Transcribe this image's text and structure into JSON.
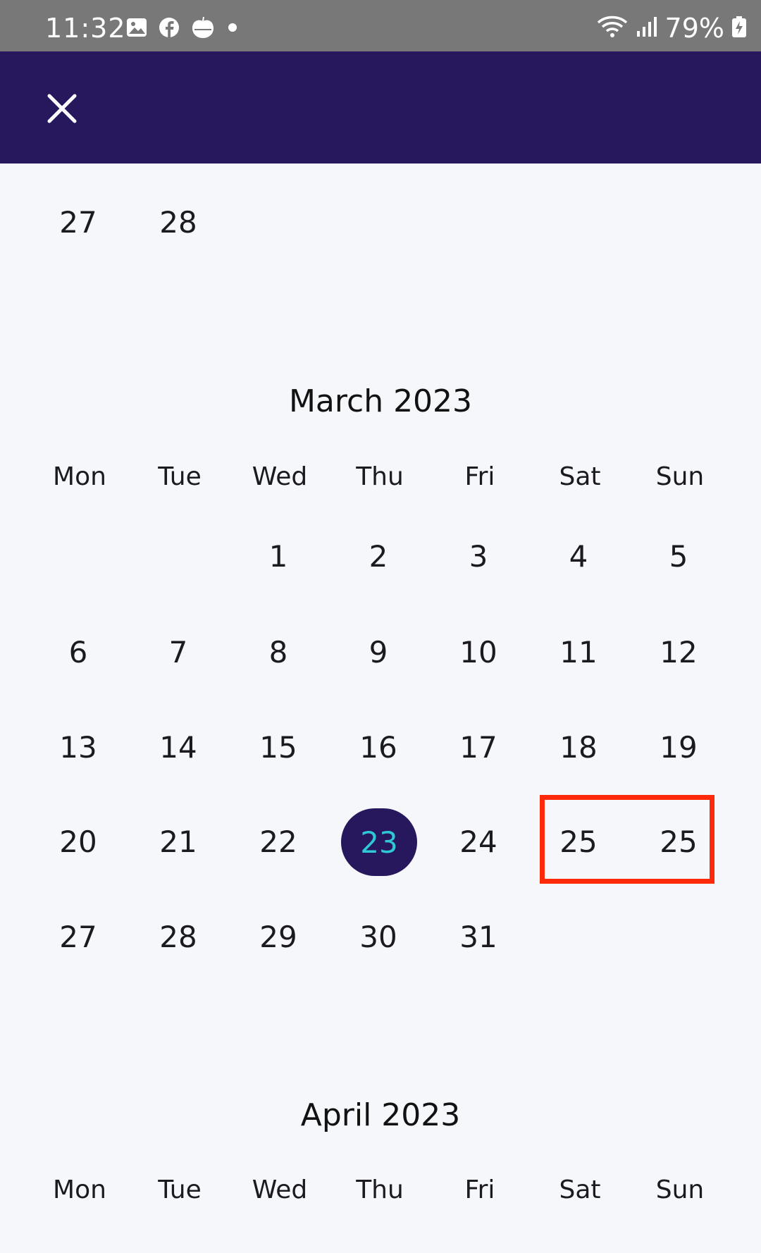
{
  "status_bar": {
    "time": "11:32",
    "battery": "79%",
    "icons_left": [
      "gallery-icon",
      "facebook-icon",
      "apple-timer-icon",
      "dot-icon"
    ],
    "icons_right": [
      "wifi-icon",
      "signal-icon",
      "battery-icon"
    ]
  },
  "app_bar": {
    "close_icon": "close-icon",
    "background": "#27185d"
  },
  "prev_month_tail": [
    "27",
    "28"
  ],
  "months": [
    {
      "title": "March 2023",
      "weekdays": [
        "Mon",
        "Tue",
        "Wed",
        "Thu",
        "Fri",
        "Sat",
        "Sun"
      ],
      "weeks": [
        [
          "",
          "",
          "1",
          "2",
          "3",
          "4",
          "5"
        ],
        [
          "6",
          "7",
          "8",
          "9",
          "10",
          "11",
          "12"
        ],
        [
          "13",
          "14",
          "15",
          "16",
          "17",
          "18",
          "19"
        ],
        [
          "20",
          "21",
          "22",
          "23",
          "24",
          "25",
          "25"
        ],
        [
          "27",
          "28",
          "29",
          "30",
          "31",
          "",
          ""
        ]
      ],
      "selected": "23"
    },
    {
      "title": "April 2023",
      "weekdays": [
        "Mon",
        "Tue",
        "Wed",
        "Thu",
        "Fri",
        "Sat",
        "Sun"
      ]
    }
  ],
  "colors": {
    "accent": "#27185d",
    "selected_text": "#2fc8d8",
    "highlight": "#ff2a0a"
  }
}
